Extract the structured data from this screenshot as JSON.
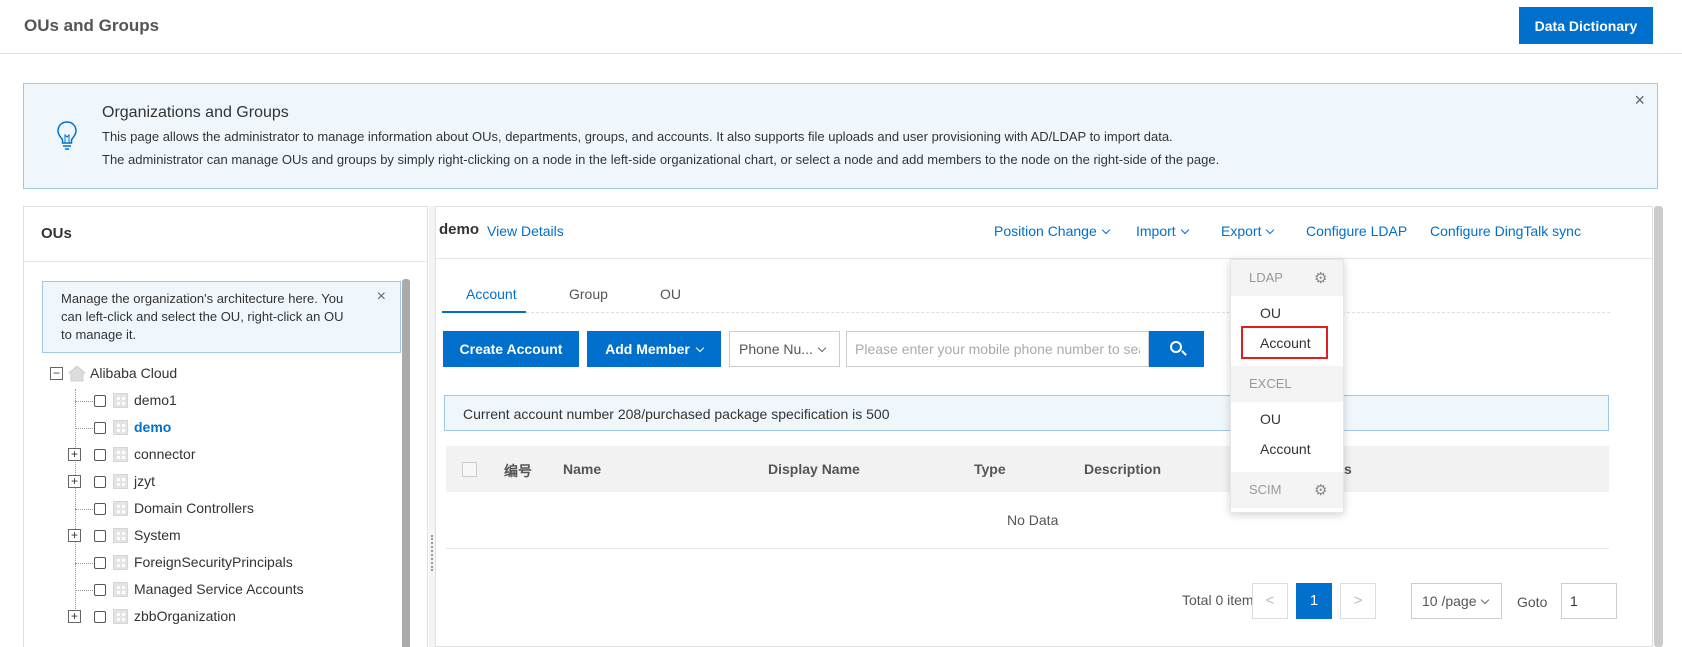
{
  "header": {
    "title": "OUs and Groups",
    "data_dictionary_label": "Data Dictionary"
  },
  "notice": {
    "title": "Organizations and Groups",
    "line1": "This page allows the administrator to manage information about OUs, departments, groups, and accounts. It also supports file uploads and user provisioning with AD/LDAP to import data.",
    "line2": "The administrator can manage OUs and groups by simply right-clicking on a node in the left-side organizational chart, or select a node and add members to the node on the right-side of the page.",
    "close_icon": "×",
    "icon": "lightbulb-icon"
  },
  "left_panel": {
    "title": "OUs",
    "tip_text": "Manage the organization's architecture here. You can left-click and select the OU, right-click an OU to manage it.",
    "tip_close": "×",
    "tree": {
      "root": "Alibaba Cloud",
      "children": [
        {
          "label": "demo1",
          "expandable": false,
          "selected": false
        },
        {
          "label": "demo",
          "expandable": false,
          "selected": true
        },
        {
          "label": "connector",
          "expandable": true,
          "selected": false
        },
        {
          "label": "jzyt",
          "expandable": true,
          "selected": false
        },
        {
          "label": "Domain Controllers",
          "expandable": false,
          "selected": false
        },
        {
          "label": "System",
          "expandable": true,
          "selected": false
        },
        {
          "label": "ForeignSecurityPrincipals",
          "expandable": false,
          "selected": false
        },
        {
          "label": "Managed Service Accounts",
          "expandable": false,
          "selected": false
        },
        {
          "label": "zbbOrganization",
          "expandable": true,
          "selected": false
        }
      ],
      "collapse_glyph": "−",
      "expand_glyph": "+"
    }
  },
  "main": {
    "ou_name": "demo",
    "view_details": "View Details",
    "header_links": {
      "position_change": "Position Change",
      "import": "Import",
      "export": "Export",
      "configure_ldap": "Configure LDAP",
      "configure_dingtalk": "Configure DingTalk sync"
    },
    "tabs": [
      "Account",
      "Group",
      "OU"
    ],
    "active_tab": "Account",
    "create_account": "Create Account",
    "add_member": "Add Member",
    "search_field_select": "Phone Nu...",
    "search_placeholder": "Please enter your mobile phone number to search",
    "info_text": "Current account number 208/purchased package specification is 500",
    "table": {
      "columns": [
        "编号",
        "Name",
        "Display Name",
        "Type",
        "Description"
      ],
      "partial_column_fragment": "s",
      "empty_text": "No Data"
    },
    "pagination": {
      "total": "Total 0 item",
      "prev": "<",
      "current_page": "1",
      "next": ">",
      "page_size": "10 /page",
      "goto_label": "Goto",
      "goto_value": "1"
    }
  },
  "import_dropdown": {
    "ldap_group": "LDAP",
    "ldap_items": [
      "OU",
      "Account"
    ],
    "excel_group": "EXCEL",
    "excel_items": [
      "OU",
      "Account"
    ],
    "scim_group": "SCIM",
    "gear_glyph": "⚙",
    "highlighted_item": "Account"
  },
  "colors": {
    "primary": "#0070cc",
    "highlight_border": "#e02020",
    "notice_bg": "#f0f7fc"
  }
}
